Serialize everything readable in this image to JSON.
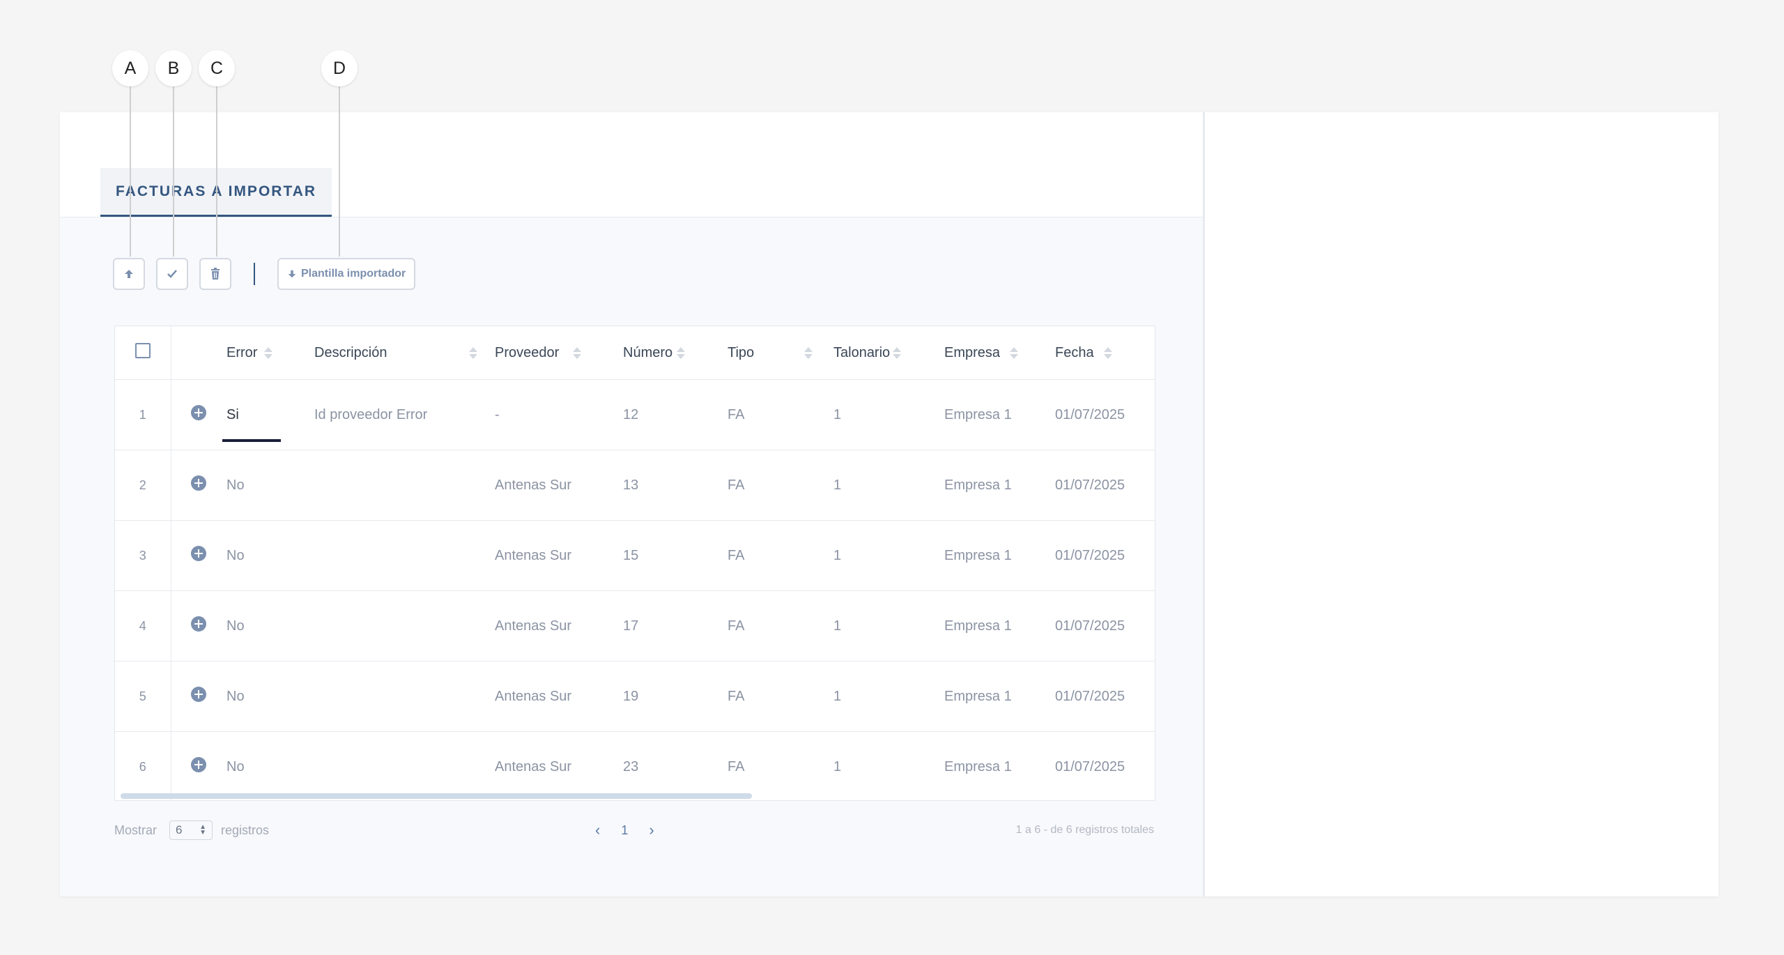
{
  "callouts": [
    "A",
    "B",
    "C",
    "D"
  ],
  "tab": {
    "label": "FACTURAS A IMPORTAR"
  },
  "toolbar": {
    "upload_icon": "arrow-up-icon",
    "check_icon": "check-icon",
    "delete_icon": "trash-icon",
    "template_button": "Plantilla importador",
    "template_icon": "arrow-down-icon"
  },
  "table": {
    "columns": [
      "Error",
      "Descripción",
      "Proveedor",
      "Número",
      "Tipo",
      "Talonario",
      "Empresa",
      "Fecha"
    ],
    "rows": [
      {
        "idx": "1",
        "error": "Si",
        "descripcion": "Id proveedor Error",
        "proveedor": "-",
        "numero": "12",
        "tipo": "FA",
        "talonario": "1",
        "empresa": "Empresa 1",
        "fecha": "01/07/2025"
      },
      {
        "idx": "2",
        "error": "No",
        "descripcion": "",
        "proveedor": "Antenas Sur",
        "numero": "13",
        "tipo": "FA",
        "talonario": "1",
        "empresa": "Empresa 1",
        "fecha": "01/07/2025"
      },
      {
        "idx": "3",
        "error": "No",
        "descripcion": "",
        "proveedor": "Antenas Sur",
        "numero": "15",
        "tipo": "FA",
        "talonario": "1",
        "empresa": "Empresa 1",
        "fecha": "01/07/2025"
      },
      {
        "idx": "4",
        "error": "No",
        "descripcion": "",
        "proveedor": "Antenas Sur",
        "numero": "17",
        "tipo": "FA",
        "talonario": "1",
        "empresa": "Empresa 1",
        "fecha": "01/07/2025"
      },
      {
        "idx": "5",
        "error": "No",
        "descripcion": "",
        "proveedor": "Antenas Sur",
        "numero": "19",
        "tipo": "FA",
        "talonario": "1",
        "empresa": "Empresa 1",
        "fecha": "01/07/2025"
      },
      {
        "idx": "6",
        "error": "No",
        "descripcion": "",
        "proveedor": "Antenas Sur",
        "numero": "23",
        "tipo": "FA",
        "talonario": "1",
        "empresa": "Empresa 1",
        "fecha": "01/07/2025"
      }
    ]
  },
  "footer": {
    "show_label": "Mostrar",
    "page_size": "6",
    "records_label": "registros",
    "current_page": "1",
    "summary": "1 a 6 - de 6 registros totales"
  },
  "colors": {
    "accent": "#34567f",
    "icon": "#7b8fae"
  }
}
